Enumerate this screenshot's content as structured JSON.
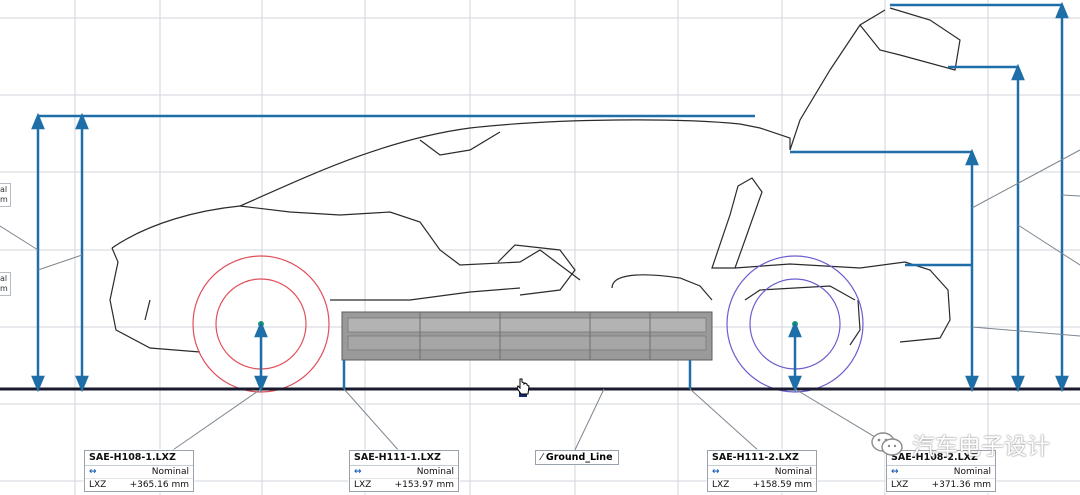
{
  "callouts": [
    {
      "id": "h108_1",
      "title": "SAE-H108-1.LXZ",
      "header_label": "Nominal",
      "row_label": "LXZ",
      "value": "+365.16 mm"
    },
    {
      "id": "h111_1",
      "title": "SAE-H111-1.LXZ",
      "header_label": "Nominal",
      "row_label": "LXZ",
      "value": "+153.97 mm"
    },
    {
      "id": "h111_2",
      "title": "SAE-H111-2.LXZ",
      "header_label": "Nominal",
      "row_label": "LXZ",
      "value": "+158.59 mm"
    },
    {
      "id": "h108_2",
      "title": "SAE-H108-2.LXZ",
      "header_label": "Nominal",
      "row_label": "LXZ",
      "value": "+371.36 mm"
    }
  ],
  "ground_line": {
    "label": "Ground_Line",
    "icon": "line-icon"
  },
  "side_tags": [
    {
      "text": "al m"
    },
    {
      "text": "al m"
    }
  ],
  "watermark": {
    "text": "汽车电子设计",
    "icon": "wechat-icon"
  },
  "colors": {
    "dimension": "#1e6fa8",
    "outline": "#2b2b2b",
    "grid": "#d2d6db",
    "front_wheel": "#e0505a",
    "rear_wheel": "#6a5fcf",
    "sill": "#8d8d8d",
    "ground": "#1a1a2e"
  }
}
